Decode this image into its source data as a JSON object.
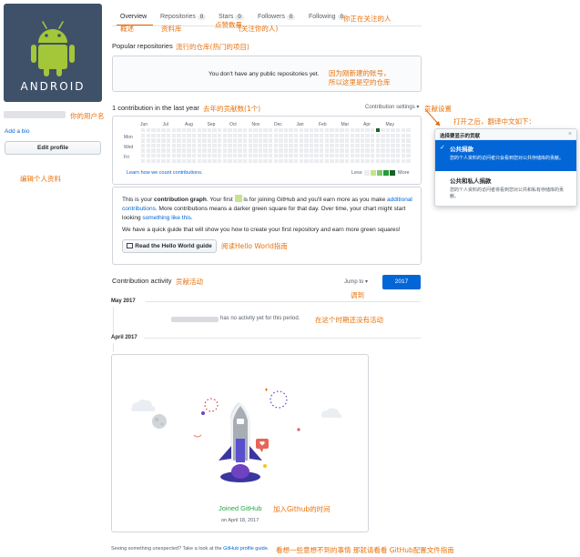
{
  "sidebar": {
    "avatar_text": "ANDROID",
    "username_anno": "你的用户名",
    "add_bio": "Add a bio",
    "edit_profile": "Edit profile",
    "edit_profile_anno": "编辑个人资料"
  },
  "tabs": [
    {
      "label": "Overview",
      "anno": "概述"
    },
    {
      "label": "Repositories",
      "count": "0",
      "anno": "资料库"
    },
    {
      "label": "Stars",
      "count": "0",
      "anno": "点赞数量"
    },
    {
      "label": "Followers",
      "count": "0",
      "anno": "(关注你的人)"
    },
    {
      "label": "Following",
      "count": "0",
      "anno": "你正在关注的人"
    }
  ],
  "repos": {
    "title": "Popular repositories",
    "title_anno": "流行的仓库(热门的项目)",
    "empty": "You don't have any public repositories yet.",
    "empty_anno1": "因为刚新建的账号，",
    "empty_anno2": "所以这里是空的仓库"
  },
  "contrib": {
    "title": "1 contribution in the last year",
    "title_anno": "去年的贡献数(1个)",
    "settings": "Contribution settings ▾",
    "settings_anno": "贡献设置",
    "open_anno": "打开之后，翻译中文如下：",
    "months": [
      "Jun",
      "Jul",
      "Aug",
      "Sep",
      "Oct",
      "Nov",
      "Dec",
      "Jan",
      "Feb",
      "Mar",
      "Apr",
      "May"
    ],
    "days": [
      "Mon",
      "Wed",
      "Fri"
    ],
    "learn": "Learn how we count contributions.",
    "less": "Less",
    "more": "More",
    "legend_colors": [
      "#ebedf0",
      "#c6e48b",
      "#7bc96f",
      "#239a3b",
      "#196127"
    ],
    "active_color": "#196127"
  },
  "popup": {
    "header": "选择要显示的贡献",
    "opt1_title": "公共捐款",
    "opt1_desc": "您的个人资料的访问者只会看到您对公共存储库的贡献。",
    "opt2_title": "公共和私人捐款",
    "opt2_desc": "您的个人资料的访问者将看到您对公共和私有存储库的贡献。"
  },
  "info": {
    "p1_a": "This is your ",
    "p1_b": "contribution graph",
    "p1_c": ". Your first",
    "p1_d": "is for joining GitHub and you'll earn more as you make",
    "p1_e": "additional contributions",
    "p1_f": ". More contributions means a darker green square for that day. Over time, your chart",
    "p1_g": "might start looking",
    "p1_h": "something like this",
    "p1_i": ".",
    "p2": "We have a quick guide that will show you how to create your first repository and earn more green squares!",
    "guide_btn": "Read the Hello World guide",
    "guide_anno": "阅读Hello World指南"
  },
  "activity": {
    "title": "Contribution activity",
    "title_anno": "贡献活动",
    "jump": "Jump to ▾",
    "jump_anno": "调到",
    "year": "2017",
    "may": "May 2017",
    "no_activity": "has no activity yet for this period.",
    "no_activity_anno": "在这个时期还没有活动",
    "april": "April 2017",
    "joined": "Joined GitHub",
    "joined_anno": "加入Github的时间",
    "joined_date": "on April 18, 2017"
  },
  "footer": {
    "text": "Seeing something unexpected? Take a look at the",
    "link": "GitHub profile guide",
    "text_end": ".",
    "anno": "看想一些意想不到的事情 那就请看看 GitHub配置文件指南"
  }
}
